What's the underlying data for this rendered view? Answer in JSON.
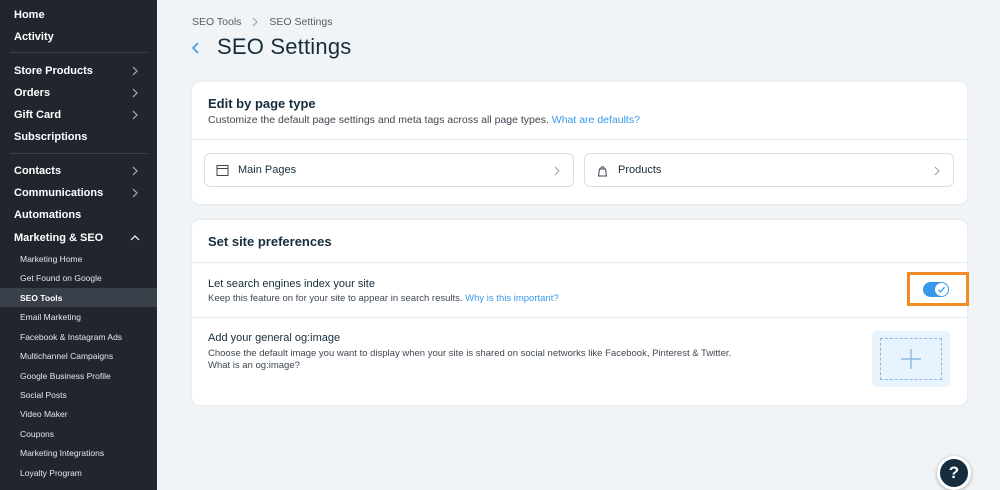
{
  "sidebar": {
    "top_items": [
      {
        "label": "Home"
      },
      {
        "label": "Activity"
      }
    ],
    "group1": [
      {
        "label": "Store Products"
      },
      {
        "label": "Orders"
      },
      {
        "label": "Gift Card"
      },
      {
        "label": "Subscriptions"
      }
    ],
    "group2": [
      {
        "label": "Contacts"
      },
      {
        "label": "Communications"
      },
      {
        "label": "Automations"
      },
      {
        "label": "Marketing & SEO"
      }
    ],
    "marketing_sub": [
      {
        "label": "Marketing Home"
      },
      {
        "label": "Get Found on Google"
      },
      {
        "label": "SEO Tools"
      },
      {
        "label": "Email Marketing"
      },
      {
        "label": "Facebook & Instagram Ads"
      },
      {
        "label": "Multichannel Campaigns"
      },
      {
        "label": "Google Business Profile"
      },
      {
        "label": "Social Posts"
      },
      {
        "label": "Video Maker"
      },
      {
        "label": "Coupons"
      },
      {
        "label": "Marketing Integrations"
      },
      {
        "label": "Loyalty Program"
      }
    ]
  },
  "breadcrumb": {
    "parent": "SEO Tools",
    "current": "SEO Settings"
  },
  "page": {
    "title": "SEO Settings"
  },
  "page_type_card": {
    "title": "Edit by page type",
    "subtitle": "Customize the default page settings and meta tags across all page types.",
    "link": "What are defaults?",
    "main_pages": "Main Pages",
    "products": "Products"
  },
  "preferences_card": {
    "title": "Set site preferences",
    "index_title": "Let search engines index your site",
    "index_sub": "Keep this feature on for your site to appear in search results.",
    "index_link": "Why is this important?",
    "index_enabled": true,
    "og_title": "Add your general og:image",
    "og_sub": "Choose the default image you want to display when your site is shared on social networks like Facebook, Pinterest & Twitter.",
    "og_link": "What is an og:image?"
  },
  "help": {
    "label": "?"
  },
  "colors": {
    "sidebar_bg": "#20252e",
    "accent": "#3899ec",
    "highlight": "#f28a25",
    "page_bg": "#f0f4f7"
  }
}
